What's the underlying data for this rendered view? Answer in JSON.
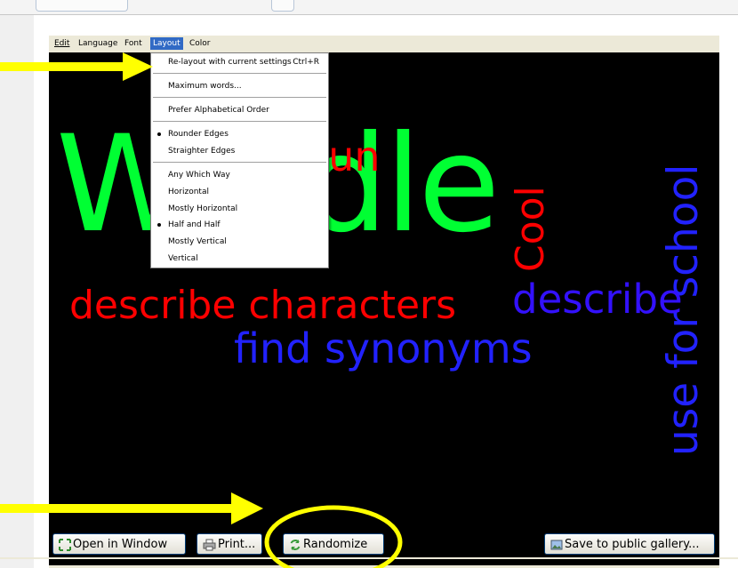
{
  "menubar": {
    "items": [
      {
        "label": "Edit"
      },
      {
        "label": "Language"
      },
      {
        "label": "Font"
      },
      {
        "label": "Layout"
      },
      {
        "label": "Color"
      }
    ]
  },
  "layout_menu": {
    "relayout": {
      "label": "Re-layout with current settings",
      "shortcut": "Ctrl+R"
    },
    "max_words": "Maximum words...",
    "alpha": "Prefer Alphabetical Order",
    "rounder": "Rounder Edges",
    "straighter": "Straighter Edges",
    "any": "Any Which Way",
    "horizontal": "Horizontal",
    "mostly_h": "Mostly Horizontal",
    "half": "Half and Half",
    "mostly_v": "Mostly Vertical",
    "vertical": "Vertical"
  },
  "cloud": {
    "words": {
      "wordle": "Wordle",
      "fun": "fun",
      "cool": "Cool",
      "use_for_school": "use for school",
      "describe_characters": "describe characters",
      "describe": "describe",
      "find_synonyms": "find synonyms"
    },
    "colors": {
      "green": "#00ff33",
      "red": "#ff0000",
      "blue": "#2222ff",
      "blue_purple": "#3311ff",
      "background": "#000000"
    }
  },
  "buttons": {
    "open_window": "Open in Window",
    "print": "Print...",
    "randomize": "Randomize",
    "save_gallery": "Save to public gallery..."
  },
  "annotation": {
    "arrow_color": "#ffff00",
    "circle_color": "#ffff00"
  }
}
